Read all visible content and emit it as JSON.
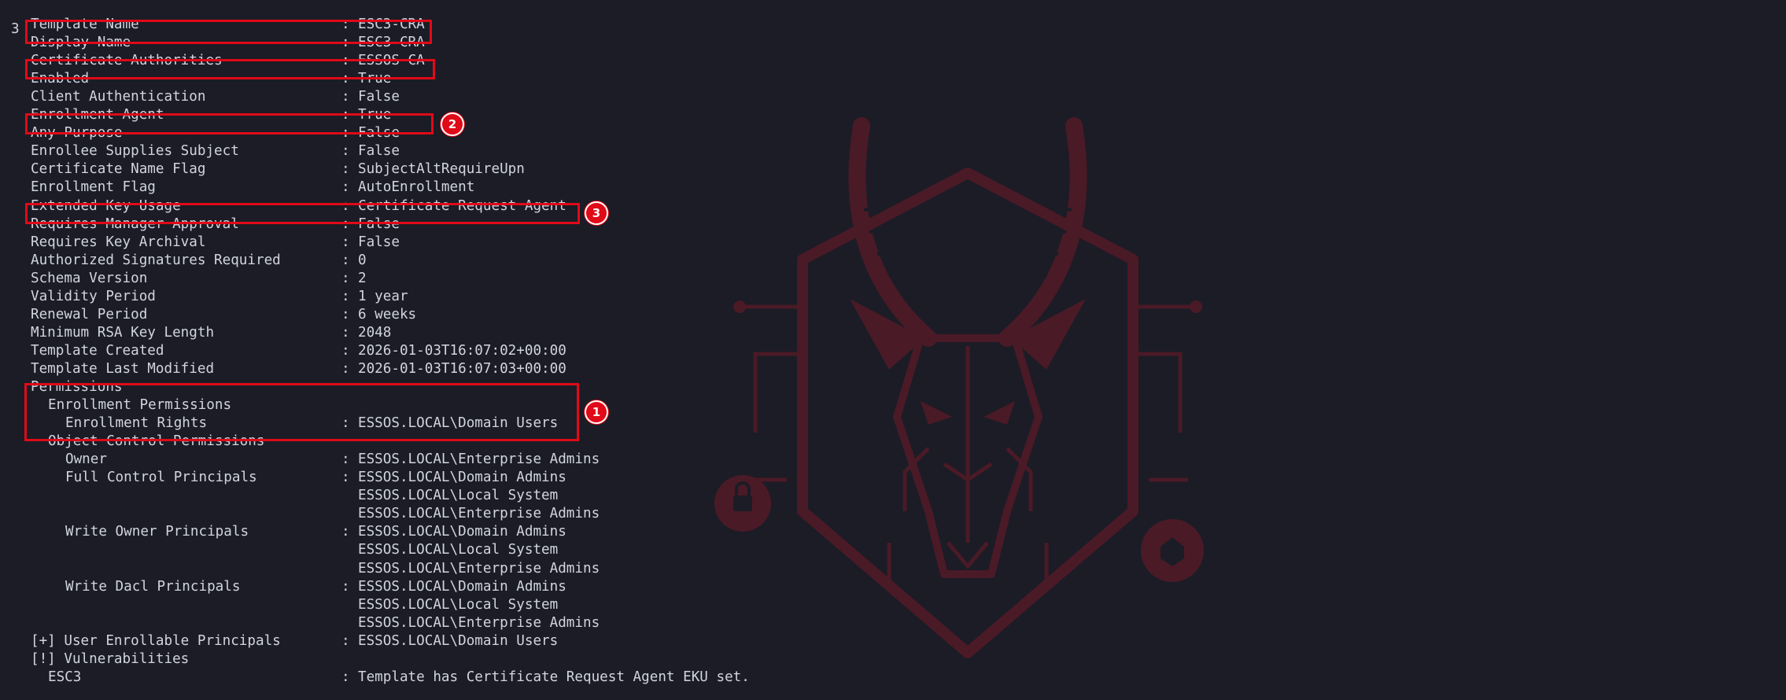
{
  "prompt_line": "3",
  "rows": [
    {
      "label": "Template Name",
      "indent": 0,
      "value": "ESC3-CRA"
    },
    {
      "label": "Display Name",
      "indent": 0,
      "value": "ESC3-CRA"
    },
    {
      "label": "Certificate Authorities",
      "indent": 0,
      "value": "ESSOS-CA"
    },
    {
      "label": "Enabled",
      "indent": 0,
      "value": "True"
    },
    {
      "label": "Client Authentication",
      "indent": 0,
      "value": "False"
    },
    {
      "label": "Enrollment Agent",
      "indent": 0,
      "value": "True"
    },
    {
      "label": "Any Purpose",
      "indent": 0,
      "value": "False"
    },
    {
      "label": "Enrollee Supplies Subject",
      "indent": 0,
      "value": "False"
    },
    {
      "label": "Certificate Name Flag",
      "indent": 0,
      "value": "SubjectAltRequireUpn"
    },
    {
      "label": "Enrollment Flag",
      "indent": 0,
      "value": "AutoEnrollment"
    },
    {
      "label": "Extended Key Usage",
      "indent": 0,
      "value": "Certificate Request Agent"
    },
    {
      "label": "Requires Manager Approval",
      "indent": 0,
      "value": "False"
    },
    {
      "label": "Requires Key Archival",
      "indent": 0,
      "value": "False"
    },
    {
      "label": "Authorized Signatures Required",
      "indent": 0,
      "value": "0"
    },
    {
      "label": "Schema Version",
      "indent": 0,
      "value": "2"
    },
    {
      "label": "Validity Period",
      "indent": 0,
      "value": "1 year"
    },
    {
      "label": "Renewal Period",
      "indent": 0,
      "value": "6 weeks"
    },
    {
      "label": "Minimum RSA Key Length",
      "indent": 0,
      "value": "2048"
    },
    {
      "label": "Template Created",
      "indent": 0,
      "value": "2026-01-03T16:07:02+00:00"
    },
    {
      "label": "Template Last Modified",
      "indent": 0,
      "value": "2026-01-03T16:07:03+00:00"
    },
    {
      "label": "Permissions",
      "indent": 0,
      "value": null
    },
    {
      "label": "Enrollment Permissions",
      "indent": 1,
      "value": null
    },
    {
      "label": "Enrollment Rights",
      "indent": 2,
      "value": "ESSOS.LOCAL\\Domain Users"
    },
    {
      "label": "Object Control Permissions",
      "indent": 1,
      "value": null
    },
    {
      "label": "Owner",
      "indent": 2,
      "value": "ESSOS.LOCAL\\Enterprise Admins"
    },
    {
      "label": "Full Control Principals",
      "indent": 2,
      "value": "ESSOS.LOCAL\\Domain Admins"
    },
    {
      "label": "",
      "indent": 2,
      "value": "ESSOS.LOCAL\\Local System",
      "cont": true
    },
    {
      "label": "",
      "indent": 2,
      "value": "ESSOS.LOCAL\\Enterprise Admins",
      "cont": true
    },
    {
      "label": "Write Owner Principals",
      "indent": 2,
      "value": "ESSOS.LOCAL\\Domain Admins"
    },
    {
      "label": "",
      "indent": 2,
      "value": "ESSOS.LOCAL\\Local System",
      "cont": true
    },
    {
      "label": "",
      "indent": 2,
      "value": "ESSOS.LOCAL\\Enterprise Admins",
      "cont": true
    },
    {
      "label": "Write Dacl Principals",
      "indent": 2,
      "value": "ESSOS.LOCAL\\Domain Admins"
    },
    {
      "label": "",
      "indent": 2,
      "value": "ESSOS.LOCAL\\Local System",
      "cont": true
    },
    {
      "label": "",
      "indent": 2,
      "value": "ESSOS.LOCAL\\Enterprise Admins",
      "cont": true
    },
    {
      "label": "[+] User Enrollable Principals",
      "indent": 0,
      "value": "ESSOS.LOCAL\\Domain Users"
    },
    {
      "label": "[!] Vulnerabilities",
      "indent": 0,
      "value": null
    },
    {
      "label": "ESC3",
      "indent": 1,
      "value": "Template has Certificate Request Agent EKU set."
    }
  ],
  "separator": ":",
  "badges": [
    "1",
    "2",
    "3"
  ],
  "colors": {
    "background": "#1b1c26",
    "text": "#d2d4e0",
    "highlight": "#e00a18",
    "watermark": "#4a1a26"
  },
  "icons": [
    "antelope-shield-logo-icon"
  ]
}
